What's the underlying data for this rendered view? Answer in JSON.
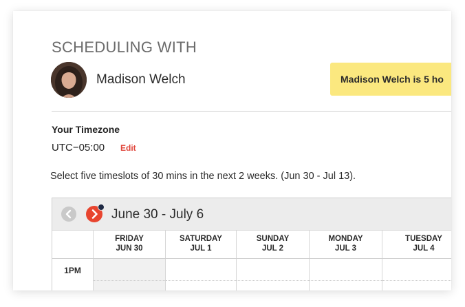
{
  "scheduling": {
    "heading": "SCHEDULING WITH",
    "person_name": "Madison Welch",
    "banner_text": "Madison Welch is 5 ho"
  },
  "timezone": {
    "label": "Your Timezone",
    "value": "UTC−05:00",
    "edit_label": "Edit"
  },
  "instructions": "Select five timeslots of 30 mins in the next 2 weeks. (Jun 30 - Jul 13).",
  "calendar": {
    "range_label": "June 30 - July 6",
    "days": [
      {
        "weekday": "FRIDAY",
        "date": "JUN 30"
      },
      {
        "weekday": "SATURDAY",
        "date": "JUL 1"
      },
      {
        "weekday": "SUNDAY",
        "date": "JUL 2"
      },
      {
        "weekday": "MONDAY",
        "date": "JUL 3"
      },
      {
        "weekday": "TUESDAY",
        "date": "JUL 4"
      }
    ],
    "time_label": "1PM"
  },
  "colors": {
    "accent": "#e8452f",
    "banner": "#fbe87f",
    "edit": "#e0453a"
  }
}
